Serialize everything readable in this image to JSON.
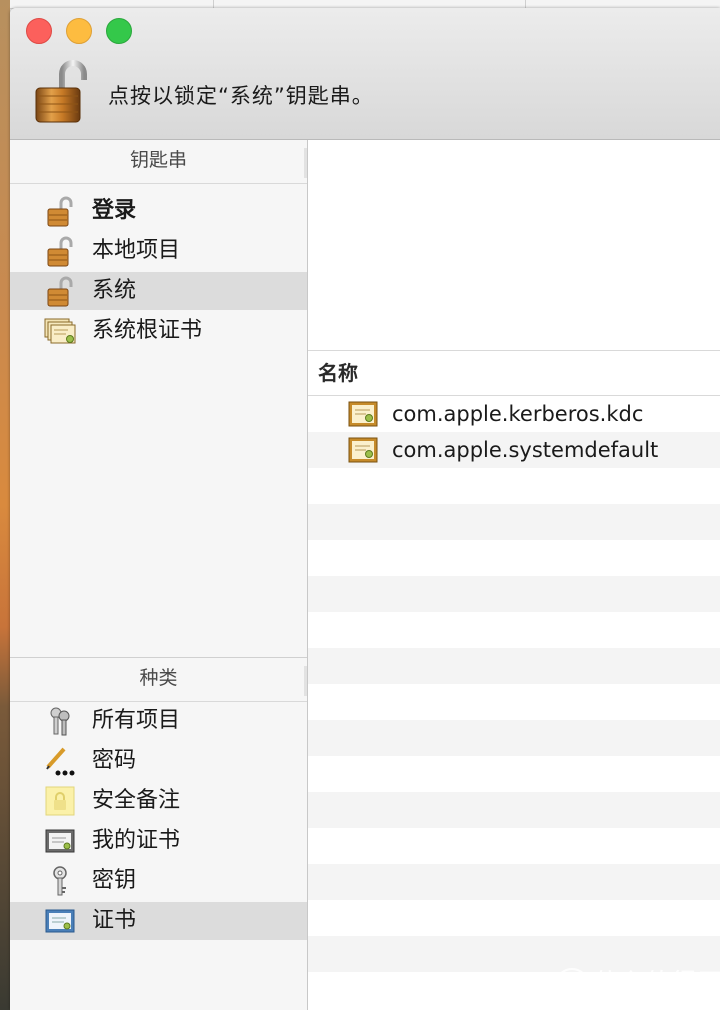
{
  "window": {
    "lock_message": "点按以锁定“系统”钥匙串。"
  },
  "sidebar": {
    "keychains_header": "钥匙串",
    "keychains": [
      {
        "label": "登录",
        "icon": "open-lock-icon",
        "bold": true
      },
      {
        "label": "本地项目",
        "icon": "open-lock-icon"
      },
      {
        "label": "系统",
        "icon": "open-lock-icon",
        "selected": true
      },
      {
        "label": "系统根证书",
        "icon": "certificates-icon"
      }
    ],
    "category_header": "种类",
    "categories": [
      {
        "label": "所有项目",
        "icon": "all-items-icon"
      },
      {
        "label": "密码",
        "icon": "password-icon"
      },
      {
        "label": "安全备注",
        "icon": "secure-note-icon"
      },
      {
        "label": "我的证书",
        "icon": "my-certificate-icon"
      },
      {
        "label": "密钥",
        "icon": "key-icon"
      },
      {
        "label": "证书",
        "icon": "certificate-icon",
        "selected": true
      }
    ]
  },
  "content": {
    "column_name": "名称",
    "items": [
      {
        "name": "com.apple.kerberos.kdc",
        "icon": "certificate-icon"
      },
      {
        "name": "com.apple.systemdefault",
        "icon": "certificate-icon"
      }
    ]
  },
  "watermark": {
    "symbol": "值",
    "text": "什么值得买"
  },
  "colors": {
    "close": "#fc605c",
    "minimize": "#fdbc40",
    "maximize": "#34c84a",
    "selection": "#dcdcdc"
  }
}
